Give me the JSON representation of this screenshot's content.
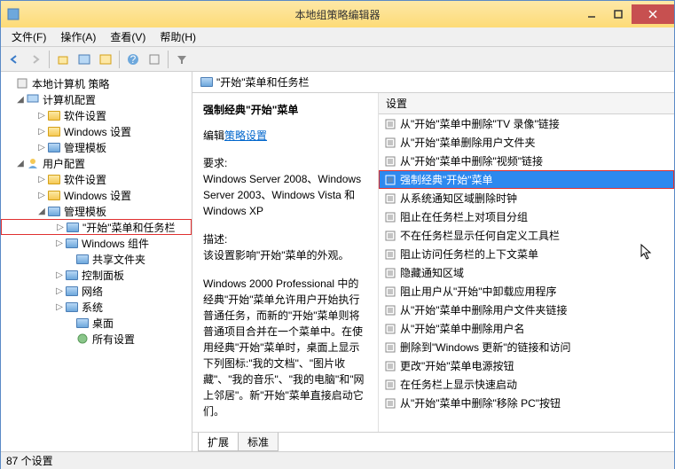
{
  "window": {
    "title": "本地组策略编辑器"
  },
  "menu": {
    "file": "文件(F)",
    "action": "操作(A)",
    "view": "查看(V)",
    "help": "帮助(H)"
  },
  "tree": {
    "root": "本地计算机 策略",
    "computer": "计算机配置",
    "user": "用户配置",
    "software": "软件设置",
    "windows": "Windows 设置",
    "admin": "管理模板",
    "start_taskbar": "\"开始\"菜单和任务栏",
    "win_components": "Windows 组件",
    "shared_folders": "共享文件夹",
    "control_panel": "控制面板",
    "network": "网络",
    "system": "系统",
    "desktop": "桌面",
    "all_settings": "所有设置"
  },
  "content": {
    "header": "\"开始\"菜单和任务栏",
    "policy_title": "强制经典\"开始\"菜单",
    "edit_prefix": "编辑",
    "edit_link": "策略设置",
    "req_label": "要求:",
    "req_text": "Windows Server 2008、Windows Server 2003、Windows Vista 和 Windows XP",
    "desc_label": "描述:",
    "desc_text": "该设置影响\"开始\"菜单的外观。",
    "desc_long": "Windows 2000 Professional 中的经典\"开始\"菜单允许用户开始执行普通任务，而新的\"开始\"菜单则将普通项目合并在一个菜单中。在使用经典\"开始\"菜单时，桌面上显示下列图标:\"我的文档\"、\"图片收藏\"、\"我的音乐\"、\"我的电脑\"和\"网上邻居\"。新\"开始\"菜单直接启动它们。"
  },
  "list": {
    "header": "设置",
    "items": [
      "从\"开始\"菜单中删除\"TV 录像\"链接",
      "从\"开始\"菜单删除用户文件夹",
      "从\"开始\"菜单中删除\"视频\"链接",
      "强制经典\"开始\"菜单",
      "从系统通知区域删除时钟",
      "阻止在任务栏上对项目分组",
      "不在任务栏显示任何自定义工具栏",
      "阻止访问任务栏的上下文菜单",
      "隐藏通知区域",
      "阻止用户从\"开始\"中卸载应用程序",
      "从\"开始\"菜单中删除用户文件夹链接",
      "从\"开始\"菜单中删除用户名",
      "删除到\"Windows 更新\"的链接和访问",
      "更改\"开始\"菜单电源按钮",
      "在任务栏上显示快速启动",
      "从\"开始\"菜单中删除\"移除 PC\"按钮"
    ],
    "selected_index": 3
  },
  "tabs": {
    "extended": "扩展",
    "standard": "标准"
  },
  "status": {
    "text": "87 个设置"
  }
}
